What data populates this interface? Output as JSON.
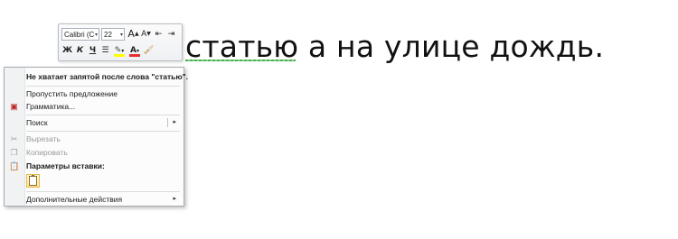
{
  "document": {
    "sentence_visible": "статью а на улице дождь.",
    "error_word": "статью"
  },
  "mini_toolbar": {
    "font_name": "Calibri (С",
    "font_size": "22",
    "grow_font": "A",
    "shrink_font": "A",
    "bold": "Ж",
    "italic": "К",
    "underline": "Ч",
    "font_color_letter": "A"
  },
  "context_menu": {
    "header": "Не хватает запятой после слова \"статью\".",
    "items": [
      {
        "label": "Пропустить предложение",
        "enabled": true
      },
      {
        "label": "Грамматика...",
        "enabled": true
      },
      {
        "label": "Поиск",
        "enabled": true
      },
      {
        "label": "Вырезать",
        "enabled": false
      },
      {
        "label": "Копировать",
        "enabled": false
      },
      {
        "label": "Параметры вставки:",
        "enabled": true
      },
      {
        "label": "Дополнительные действия",
        "enabled": true
      }
    ]
  },
  "colors": {
    "grammar_underline": "#4caf50",
    "highlight": "#ffff00",
    "font_color": "#e23030"
  }
}
